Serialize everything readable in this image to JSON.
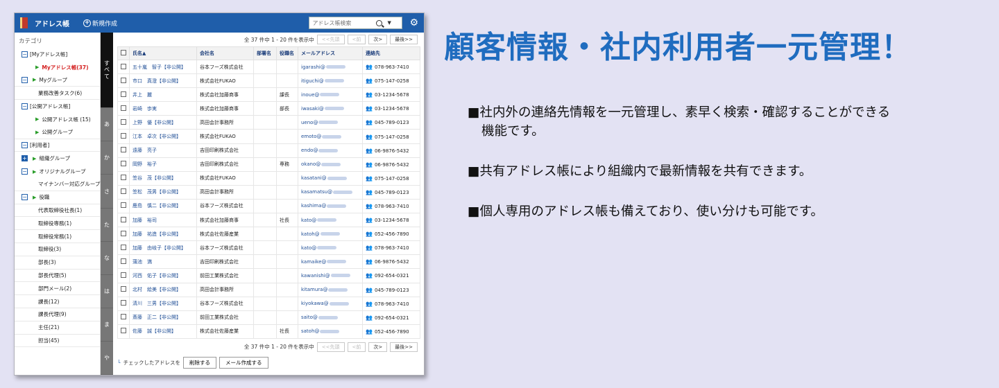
{
  "app": {
    "title": "アドレス帳",
    "new_label": "新規作成",
    "search_placeholder": "アドレス帳検索",
    "category_label": "カテゴリ"
  },
  "tree": [
    {
      "label": "[Myアドレス帳]",
      "toggle": "−",
      "indent": 0
    },
    {
      "label": "Myアドレス帳(37)",
      "arrow": true,
      "indent": 1,
      "selected": true
    },
    {
      "label": "Myグループ",
      "toggle": "−",
      "arrow": true,
      "indent": 0
    },
    {
      "label": "業務改善タスク(6)",
      "indent": 2
    },
    {
      "label": "[公開アドレス帳]",
      "toggle": "−",
      "indent": 0
    },
    {
      "label": "公開アドレス帳 (15)",
      "arrow": true,
      "indent": 1
    },
    {
      "label": "公開グループ",
      "arrow": true,
      "indent": 1
    },
    {
      "label": "[利用者]",
      "toggle": "−",
      "indent": 0
    },
    {
      "label": "組織グループ",
      "toggle": "+",
      "arrow": true,
      "indent": 0
    },
    {
      "label": "オリジナルグループ",
      "toggle": "−",
      "arrow": true,
      "indent": 0
    },
    {
      "label": "マイナンバー対応グループ",
      "indent": 2
    },
    {
      "label": "役職",
      "toggle": "−",
      "arrow": true,
      "indent": 0
    },
    {
      "label": "代表取締役社長(1)",
      "indent": 2
    },
    {
      "label": "取締役専務(1)",
      "indent": 2
    },
    {
      "label": "取締役常務(1)",
      "indent": 2
    },
    {
      "label": "取締役(3)",
      "indent": 2
    },
    {
      "label": "部長(3)",
      "indent": 2
    },
    {
      "label": "部長代理(5)",
      "indent": 2
    },
    {
      "label": "部門メール(2)",
      "indent": 2
    },
    {
      "label": "課長(12)",
      "indent": 2
    },
    {
      "label": "課長代理(9)",
      "indent": 2
    },
    {
      "label": "主任(21)",
      "indent": 2
    },
    {
      "label": "担当(45)",
      "indent": 2
    }
  ],
  "kana": [
    "すべて",
    "あ",
    "か",
    "さ",
    "た",
    "な",
    "は",
    "ま",
    "や"
  ],
  "pager": {
    "summary": "全 37 件中 1 - 20 件を表示中",
    "first": "<<先頭",
    "prev": "<前",
    "next": "次>",
    "last": "最後>>"
  },
  "columns": [
    "氏名▲",
    "会社名",
    "部署名",
    "役職名",
    "メールアドレス",
    "連絡先"
  ],
  "rows": [
    {
      "name": "五十嵐　智子【非公開】",
      "company": "谷本フーズ株式会社",
      "dept": "",
      "title": "",
      "email": "igarashi@",
      "phone": "078-963-7410"
    },
    {
      "name": "市口　真澄【非公開】",
      "company": "株式会社FUKAO",
      "dept": "",
      "title": "",
      "email": "itiguchi@",
      "phone": "075-147-0258"
    },
    {
      "name": "井上　麗",
      "company": "株式会社加藤商事",
      "dept": "",
      "title": "課長",
      "email": "inoue@",
      "phone": "03-1234-5678"
    },
    {
      "name": "岩崎　歩実",
      "company": "株式会社加藤商事",
      "dept": "",
      "title": "部長",
      "email": "iwasaki@",
      "phone": "03-1234-5678"
    },
    {
      "name": "上野　優【非公開】",
      "company": "高田会計事務所",
      "dept": "",
      "title": "",
      "email": "ueno@",
      "phone": "045-789-0123"
    },
    {
      "name": "江本　卓次【非公開】",
      "company": "株式会社FUKAO",
      "dept": "",
      "title": "",
      "email": "emoto@",
      "phone": "075-147-0258"
    },
    {
      "name": "遠藤　亮子",
      "company": "吉田印刷株式会社",
      "dept": "",
      "title": "",
      "email": "endo@",
      "phone": "06-9876-5432"
    },
    {
      "name": "岡野　裕子",
      "company": "吉田印刷株式会社",
      "dept": "",
      "title": "専務",
      "email": "okano@",
      "phone": "06-9876-5432"
    },
    {
      "name": "笠谷　茂【非公開】",
      "company": "株式会社FUKAO",
      "dept": "",
      "title": "",
      "email": "kasatani@",
      "phone": "075-147-0258"
    },
    {
      "name": "笠松　茂男【非公開】",
      "company": "高田会計事務所",
      "dept": "",
      "title": "",
      "email": "kasamatsu@",
      "phone": "045-789-0123"
    },
    {
      "name": "鹿島　慎二【非公開】",
      "company": "谷本フーズ株式会社",
      "dept": "",
      "title": "",
      "email": "kashima@",
      "phone": "078-963-7410"
    },
    {
      "name": "加藤　裕司",
      "company": "株式会社加藤商事",
      "dept": "",
      "title": "社長",
      "email": "kato@",
      "phone": "03-1234-5678"
    },
    {
      "name": "加藤　祐造【非公開】",
      "company": "株式会社佐藤産業",
      "dept": "",
      "title": "",
      "email": "katoh@",
      "phone": "052-456-7890"
    },
    {
      "name": "加藤　由岐子【非公開】",
      "company": "谷本フーズ株式会社",
      "dept": "",
      "title": "",
      "email": "kato@",
      "phone": "078-963-7410"
    },
    {
      "name": "蒲池　満",
      "company": "吉田印刷株式会社",
      "dept": "",
      "title": "",
      "email": "kamaike@",
      "phone": "06-9876-5432"
    },
    {
      "name": "河西　佑子【非公開】",
      "company": "前田工業株式会社",
      "dept": "",
      "title": "",
      "email": "kawanishi@",
      "phone": "092-654-0321"
    },
    {
      "name": "北村　絵美【非公開】",
      "company": "高田会計事務所",
      "dept": "",
      "title": "",
      "email": "kitamura@",
      "phone": "045-789-0123"
    },
    {
      "name": "清川　三男【非公開】",
      "company": "谷本フーズ株式会社",
      "dept": "",
      "title": "",
      "email": "kiyokawa@",
      "phone": "078-963-7410"
    },
    {
      "name": "斎藤　正二【非公開】",
      "company": "前田工業株式会社",
      "dept": "",
      "title": "",
      "email": "saito@",
      "phone": "092-654-0321"
    },
    {
      "name": "佐藤　誠【非公開】",
      "company": "株式会社佐藤産業",
      "dept": "",
      "title": "社長",
      "email": "satoh@",
      "phone": "052-456-7890"
    }
  ],
  "bottom": {
    "checked_label": "チェックしたアドレスを",
    "delete_label": "削除する",
    "mail_label": "メール作成する"
  },
  "promo": {
    "headline": "顧客情報・社内利用者一元管理！",
    "bullet1_line1": "■社内外の連絡先情報を一元管理し、素早く検索・確認することができる",
    "bullet1_line2": "機能です。",
    "bullet2": "■共有アドレス帳により組織内で最新情報を共有できます。",
    "bullet3": "■個人専用のアドレス帳も備えており、使い分けも可能です。"
  },
  "colors": {
    "header": "#1f5eaa",
    "headline": "#1f6cbf",
    "background": "#e3e2f3",
    "selected": "#d42020"
  }
}
